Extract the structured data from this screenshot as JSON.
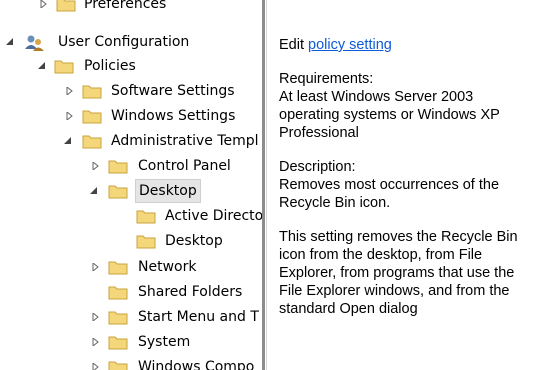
{
  "tree": {
    "preferences": "Preferences",
    "user_configuration": "User Configuration",
    "policies": "Policies",
    "software_settings": "Software Settings",
    "windows_settings": "Windows Settings",
    "administrative_templates": "Administrative Templ",
    "control_panel": "Control Panel",
    "desktop": "Desktop",
    "active_directory": "Active Directo",
    "desktop_child": "Desktop",
    "network": "Network",
    "shared_folders": "Shared Folders",
    "start_menu": "Start Menu and T",
    "system": "System",
    "windows_components": "Windows Compo"
  },
  "description": {
    "edit_prefix": "Edit ",
    "edit_link": "policy setting",
    "requirements_title": "Requirements:",
    "requirements_text": "At least Windows Server 2003 operating systems or Windows XP Professional",
    "description_title": "Description:",
    "description_text": "Removes most occurrences of the Recycle Bin icon.",
    "details_text": "This setting removes the Recycle Bin icon from the desktop, from File Explorer, from programs that use the File Explorer windows, and from the standard Open dialog"
  },
  "colors": {
    "folder_fill": "#f3d77a",
    "folder_stroke": "#c9a33c",
    "link": "#0d5bd6",
    "selection": "#e5e5e5"
  }
}
